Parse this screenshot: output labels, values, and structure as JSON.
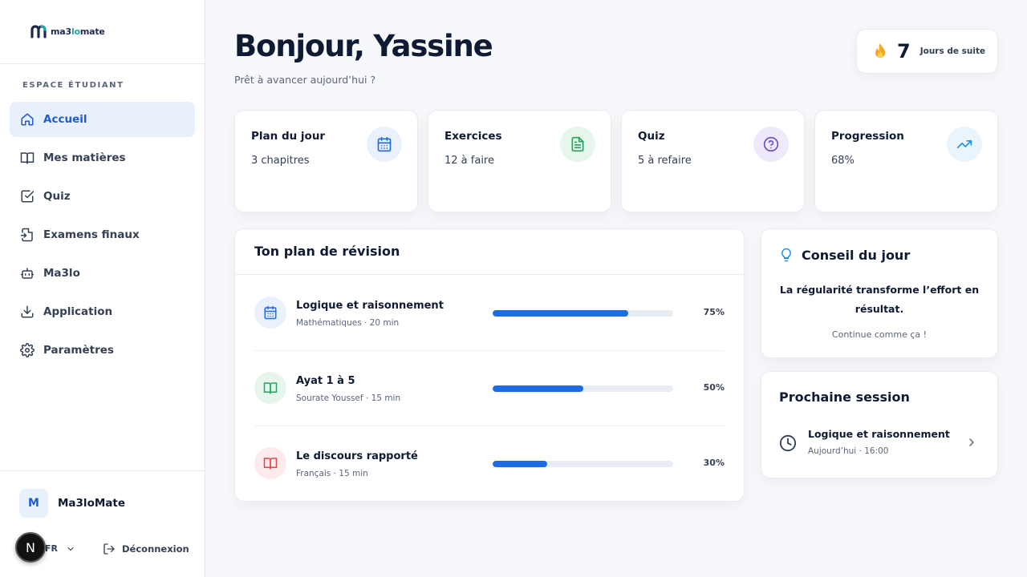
{
  "brand": {
    "logo_text_a": "ma3",
    "logo_text_b": "lo",
    "logo_text_c": "mate"
  },
  "sidebar": {
    "section_label": "ESPACE ÉTUDIANT",
    "items": [
      {
        "label": "Accueil",
        "icon": "home-icon",
        "active": true
      },
      {
        "label": "Mes matières",
        "icon": "book-icon"
      },
      {
        "label": "Quiz",
        "icon": "checkbox-icon"
      },
      {
        "label": "Examens finaux",
        "icon": "file-exam-icon"
      },
      {
        "label": "Ma3lo",
        "icon": "bot-icon"
      },
      {
        "label": "Application",
        "icon": "download-icon"
      },
      {
        "label": "Paramètres",
        "icon": "gear-icon"
      }
    ],
    "user": {
      "initial": "M",
      "name": "Ma3loMate"
    },
    "language": "FR",
    "logout_label": "Déconnexion",
    "framework_badge": "N"
  },
  "header": {
    "greeting": "Bonjour, Yassine",
    "subtitle": "Prêt à avancer aujourd’hui ?",
    "streak": {
      "count": "7",
      "label": "Jours de suite",
      "icon": "flame-icon"
    }
  },
  "stats": [
    {
      "title": "Plan du jour",
      "value": "3 chapitres",
      "icon": "calendar-icon",
      "color": "#1e6be6",
      "bg": "#eaf1fc"
    },
    {
      "title": "Exercices",
      "value": "12 à faire",
      "icon": "document-icon",
      "color": "#22a45d",
      "bg": "#e6f6ec"
    },
    {
      "title": "Quiz",
      "value": "5 à refaire",
      "icon": "help-circle-icon",
      "color": "#6b4fcf",
      "bg": "#efeafb"
    },
    {
      "title": "Progression",
      "value": "68%",
      "icon": "trending-up-icon",
      "color": "#1e8fe6",
      "bg": "#eaf4fc"
    }
  ],
  "plan": {
    "title": "Ton plan de révision",
    "rows": [
      {
        "title": "Logique et raisonnement",
        "subtitle": "Mathématiques · 20 min",
        "progress": 75,
        "progress_label": "75%",
        "icon": "calendar-icon",
        "color": "#1e6be6",
        "bg": "#eaf1fc"
      },
      {
        "title": "Ayat 1 à 5",
        "subtitle": "Sourate Youssef · 15 min",
        "progress": 50,
        "progress_label": "50%",
        "icon": "book-open-icon",
        "color": "#22a45d",
        "bg": "#e6f6ec"
      },
      {
        "title": "Le discours rapporté",
        "subtitle": "Français · 15 min",
        "progress": 30,
        "progress_label": "30%",
        "icon": "book-open-icon",
        "color": "#e0454f",
        "bg": "#fdebec"
      }
    ]
  },
  "tip": {
    "title": "Conseil du jour",
    "quote": "La régularité transforme l’effort en résultat.",
    "note": "Continue comme ça !"
  },
  "session": {
    "title": "Prochaine session",
    "name": "Logique et raisonnement",
    "time": "Aujourd’hui · 16:00"
  },
  "colors": {
    "accent": "#1e6be6",
    "active_bg": "#e8f0fb",
    "text": "#0f1b33",
    "muted": "#5b667a"
  }
}
